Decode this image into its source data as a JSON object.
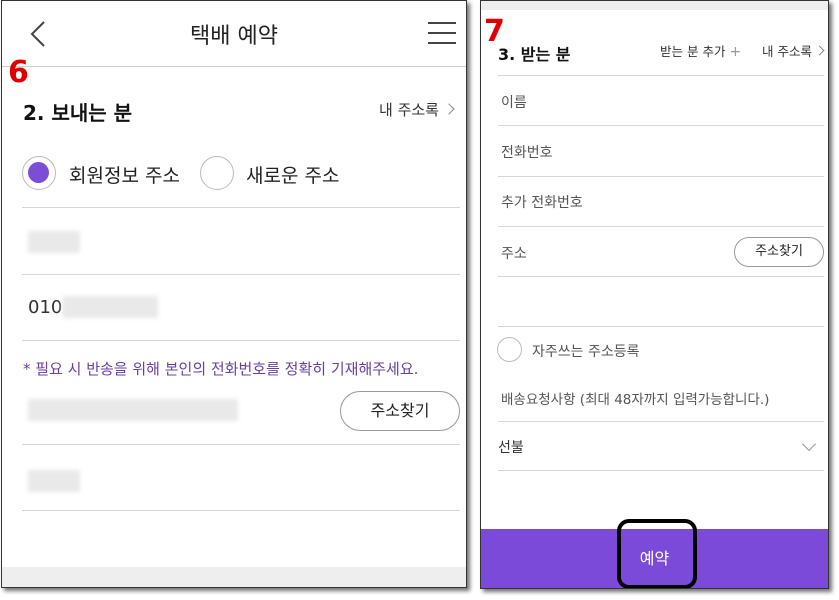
{
  "left": {
    "title": "택배 예약",
    "step_marker": "6",
    "section_title": "2. 보내는 분",
    "address_book_link": "내 주소록",
    "radio_member": "회원정보 주소",
    "radio_new": "새로운 주소",
    "phone_prefix": "010",
    "notice": "* 필요 시 반송을 위해 본인의 전화번호를 정확히 기재해주세요.",
    "find_address_button": "주소찾기"
  },
  "right": {
    "step_marker": "7",
    "section_title": "3. 받는 분",
    "add_recipient_link": "받는 분 추가",
    "address_book_link": "내 주소록",
    "name_placeholder": "이름",
    "phone_placeholder": "전화번호",
    "extra_phone_placeholder": "추가 전화번호",
    "address_label": "주소",
    "find_address_button": "주소찾기",
    "favorite_label": "자주쓰는 주소등록",
    "delivery_request_placeholder": "배송요청사항 (최대 48자까지 입력가능합니다.)",
    "payment_select_value": "선불",
    "reserve_button": "예약"
  },
  "colors": {
    "accent_purple": "#7b4ad8",
    "notice_purple": "#6b3fa0",
    "step_marker_red": "#e00000"
  }
}
